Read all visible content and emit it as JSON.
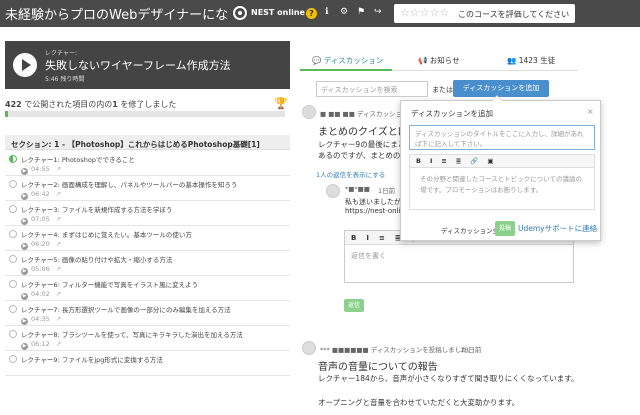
{
  "topbar": {
    "course_title": "未経験からプロのWebデザイナーにな...",
    "brand": "NEST online",
    "help_icon": "?",
    "info_icon": "ℹ",
    "settings_icon": "⚙",
    "flag_icon": "⚑",
    "share_icon": "↪",
    "stars": "☆☆☆☆☆",
    "rating_prompt": "このコースを評価してください"
  },
  "now_playing": {
    "label": "レクチャー:",
    "title": "失敗しないワイヤーフレーム作成方法",
    "time_left": "5:46 残り時間"
  },
  "progress": {
    "completed": "422",
    "text_mid": " で公開された項目の内の",
    "done": "1",
    "text_end": " を修了しました",
    "fraction": 0.003
  },
  "section": {
    "title": "セクション: 1 - 【Photoshop】これからはじめるPhotoshop基礎[1]"
  },
  "lectures": [
    {
      "title": "レクチャー1: Photoshopでできること",
      "duration": "04:55",
      "active": true
    },
    {
      "title": "レクチャー2: 画面構成を理解し、パネルやツールバーの基本操作を知ろう",
      "duration": "06:42",
      "active": false
    },
    {
      "title": "レクチャー3: ファイルを新規作成する方法を学ぼう",
      "duration": "07:05",
      "active": false
    },
    {
      "title": "レクチャー4: まずはじめに覚えたい。基本ツールの使い方",
      "duration": "06:20",
      "active": false
    },
    {
      "title": "レクチャー5: 画像の貼り付けや拡大・縮小する方法",
      "duration": "05:06",
      "active": false
    },
    {
      "title": "レクチャー6: フィルター機能で写真をイラスト風に変えよう",
      "duration": "04:02",
      "active": false
    },
    {
      "title": "レクチャー7: 長方形選択ツールで画像の一部分にのみ編集を加える方法",
      "duration": "04:35",
      "active": false
    },
    {
      "title": "レクチャー8: ブラシツールを使って、写真にキラキラした演出を加える方法",
      "duration": "06:12",
      "active": false
    },
    {
      "title": "レクチャー9: ファイルをjpg形式に変換する方法",
      "duration": "",
      "active": false
    }
  ],
  "tabs": {
    "discussion": "ディスカッション",
    "announcements": "お知らせ",
    "students": "1423 生徒"
  },
  "search": {
    "placeholder": "ディスカッションを検索",
    "or": "または",
    "add_button": "ディスカッションを追加"
  },
  "post1": {
    "author": "■ ■■ ■■ ディスカッションを",
    "title": "まとめのクイズとは",
    "body1": "レクチャー9の最後にまとめ",
    "body2": "あるのですが、まとめのク",
    "replies_link": "1人の返信を表示にする",
    "reply_author": "*■*■■",
    "reply_time": "1日前",
    "reply_body1": "私も迷いましたが、",
    "reply_body2": "https://nest-online",
    "reply_placeholder": "返信を書く",
    "submit": "返信"
  },
  "post2": {
    "author": "*** ■■■■■■ ディスカッションを投稿しました。",
    "time": "· 10日前",
    "title": "音声の音量についての報告",
    "body1": "レクチャー184から、音声が小さくなりすぎて聞き取りにくくなっています。",
    "body2": "オープニングと音量を合わせていただくと大変助かります。"
  },
  "popup": {
    "title": "ディスカッションを追加",
    "close": "×",
    "title_placeholder": "ディスカッションのタイトルをここに入力し、詳細があれば下に記入して下さい。",
    "hint": "その分野と関連したコースとトピックについての議論の場です。プロモーションはお断りします。",
    "scope": "ディスカッション全般 ▾",
    "post_button": "投稿",
    "support_link": "Udemyサポートに連絡"
  },
  "editor": {
    "bold": "B",
    "italic": "I",
    "ul": "≡",
    "ol": "≣",
    "link": "🔗",
    "image": "▣"
  }
}
